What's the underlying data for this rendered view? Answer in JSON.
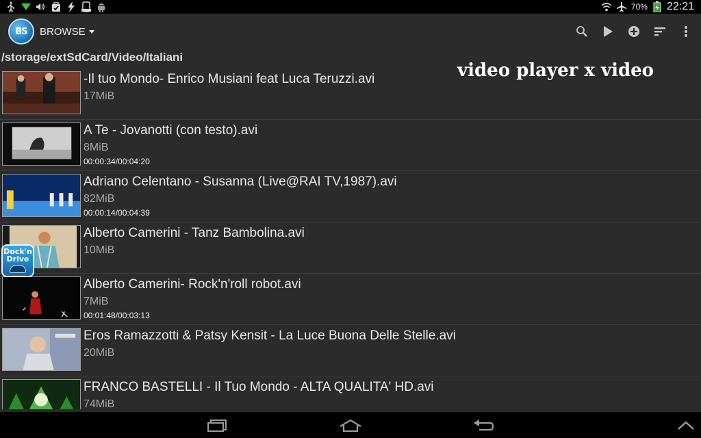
{
  "statusbar": {
    "left_icons": [
      "usb-icon",
      "wifi-down-icon",
      "volume-icon",
      "bag-check-icon",
      "charging-icon",
      "phone-icon",
      "android-icon"
    ],
    "battery_text": "70%",
    "clock": "22:21"
  },
  "actionbar": {
    "app_logo_text": "BS",
    "browse_label": "BROWSE",
    "actions": [
      "search-icon",
      "play-icon",
      "add-icon",
      "sort-icon",
      "overflow-icon"
    ]
  },
  "path": "/storage/extSdCard/Video/Italiani",
  "watermark": "video player x video",
  "badge": {
    "line1": "Dock'n",
    "line2": "Drive"
  },
  "files": [
    {
      "name": "-Il tuo Mondo- Enrico Musiani feat Luca Teruzzi.avi",
      "size": "17MiB",
      "position": ""
    },
    {
      "name": "A Te - Jovanotti (con testo).avi",
      "size": "8MiB",
      "position": "00:00:34/00:04:20"
    },
    {
      "name": "Adriano Celentano - Susanna (Live@RAI TV,1987).avi",
      "size": "82MiB",
      "position": "00:00:14/00:04:39"
    },
    {
      "name": "Alberto Camerini - Tanz Bambolina.avi",
      "size": "10MiB",
      "position": ""
    },
    {
      "name": "Alberto Camerini- Rock'n'roll robot.avi",
      "size": "7MiB",
      "position": "00:01:48/00:03:13"
    },
    {
      "name": "Eros Ramazzotti & Patsy Kensit - La Luce Buona Delle Stelle.avi",
      "size": "20MiB",
      "position": ""
    },
    {
      "name": "FRANCO BASTELLI - Il Tuo Mondo - ALTA QUALITA' HD.avi",
      "size": "74MiB",
      "position": ""
    }
  ],
  "navbar": [
    "recents-icon",
    "home-icon",
    "back-icon",
    "chevron-up-icon"
  ]
}
